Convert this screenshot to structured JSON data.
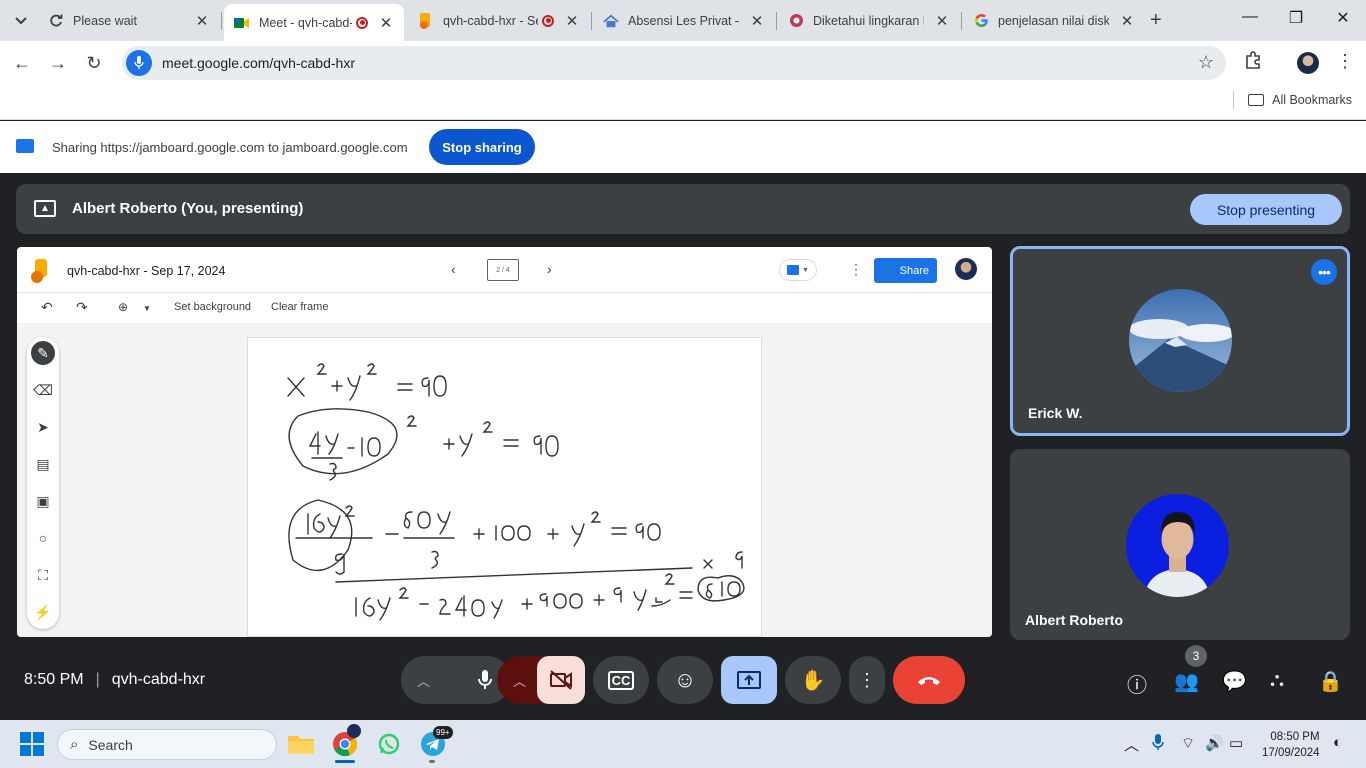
{
  "browser": {
    "tabs": [
      {
        "title": "Please wait",
        "favicon": "reload-icon",
        "active": false,
        "recording": false
      },
      {
        "title": "Meet - qvh-cabd-hxr",
        "favicon": "meet-icon",
        "active": true,
        "recording": true
      },
      {
        "title": "qvh-cabd-hxr - Se",
        "favicon": "jamboard-icon",
        "active": false,
        "recording": true
      },
      {
        "title": "Absensi Les Privat – S",
        "favicon": "sites-icon",
        "active": false,
        "recording": false
      },
      {
        "title": "Diketahui lingkaran L",
        "favicon": "brainly-icon",
        "active": false,
        "recording": false
      },
      {
        "title": "penjelasan nilai diskri",
        "favicon": "google-icon",
        "active": false,
        "recording": false
      }
    ],
    "url": "meet.google.com/qvh-cabd-hxr",
    "bookmarks_label": "All Bookmarks"
  },
  "sharing": {
    "text": "Sharing https://jamboard.google.com to jamboard.google.com",
    "stop_label": "Stop sharing"
  },
  "meet": {
    "presenting_text": "Albert Roberto (You, presenting)",
    "stop_presenting_label": "Stop presenting",
    "time": "8:50 PM",
    "meeting_code": "qvh-cabd-hxr",
    "participant_count": "3",
    "participants": [
      {
        "name": "Erick W.",
        "avatar": "mountain-photo"
      },
      {
        "name": "Albert Roberto",
        "avatar": "person-photo"
      }
    ]
  },
  "jamboard": {
    "title": "qvh-cabd-hxr - Sep 17, 2024",
    "frame_indicator": "2 / 4",
    "share_label": "Share",
    "set_background": "Set background",
    "clear_frame": "Clear frame",
    "handwriting": [
      "x² + y² = 90",
      "(4y/3 − 10)² + y² = 90",
      "16y²/9 − 80y/3 + 100 + y² = 90",
      "× 9",
      "16y² − 240y + 900 + 9y² = 810"
    ]
  },
  "taskbar": {
    "search_placeholder": "Search",
    "telegram_badge": "99+",
    "clock_time": "08:50 PM",
    "clock_date": "17/09/2024"
  },
  "colors": {
    "meet_bg": "#202124",
    "accent_blue": "#1a73e8",
    "stop_share_blue": "#0b57d0",
    "stop_presenting_bg": "#a8c7fa",
    "end_call_red": "#ea4335",
    "camera_off_bg": "#f9dedc"
  }
}
